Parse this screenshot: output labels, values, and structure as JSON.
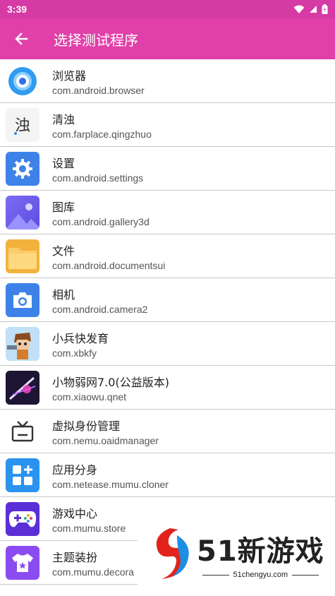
{
  "status_bar": {
    "time": "3:39",
    "icons": [
      "wifi-icon",
      "signal-icon",
      "battery-icon"
    ]
  },
  "app_bar": {
    "title": "选择测试程序",
    "back_icon": "arrow-left-icon"
  },
  "apps": [
    {
      "name": "浏览器",
      "package": "com.android.browser",
      "icon": "browser-icon"
    },
    {
      "name": "清浊",
      "package": "com.farplace.qingzhuo",
      "icon": "qingzhuo-icon"
    },
    {
      "name": "设置",
      "package": "com.android.settings",
      "icon": "settings-gear-icon"
    },
    {
      "name": "图库",
      "package": "com.android.gallery3d",
      "icon": "gallery-icon"
    },
    {
      "name": "文件",
      "package": "com.android.documentsui",
      "icon": "folder-icon"
    },
    {
      "name": "相机",
      "package": "com.android.camera2",
      "icon": "camera-icon"
    },
    {
      "name": "小兵快发育",
      "package": "com.xbkfy",
      "icon": "xbkfy-game-icon"
    },
    {
      "name": "小物弱网7.0(公益版本)",
      "package": "com.xiaowu.qnet",
      "icon": "qnet-icon"
    },
    {
      "name": "虚拟身份管理",
      "package": "com.nemu.oaidmanager",
      "icon": "tv-icon"
    },
    {
      "name": "应用分身",
      "package": "com.netease.mumu.cloner",
      "icon": "app-cloner-icon"
    },
    {
      "name": "游戏中心",
      "package": "com.mumu.store",
      "icon": "gamepad-icon"
    },
    {
      "name": "主题装扮",
      "package": "com.mumu.decora",
      "icon": "theme-shirt-icon"
    }
  ],
  "watermark": {
    "title": "51新游戏",
    "subtitle": "51chengyu.com"
  },
  "colors": {
    "status_bar": "#d63aa5",
    "app_bar": "#e040a8",
    "divider": "#c8c8c8"
  }
}
